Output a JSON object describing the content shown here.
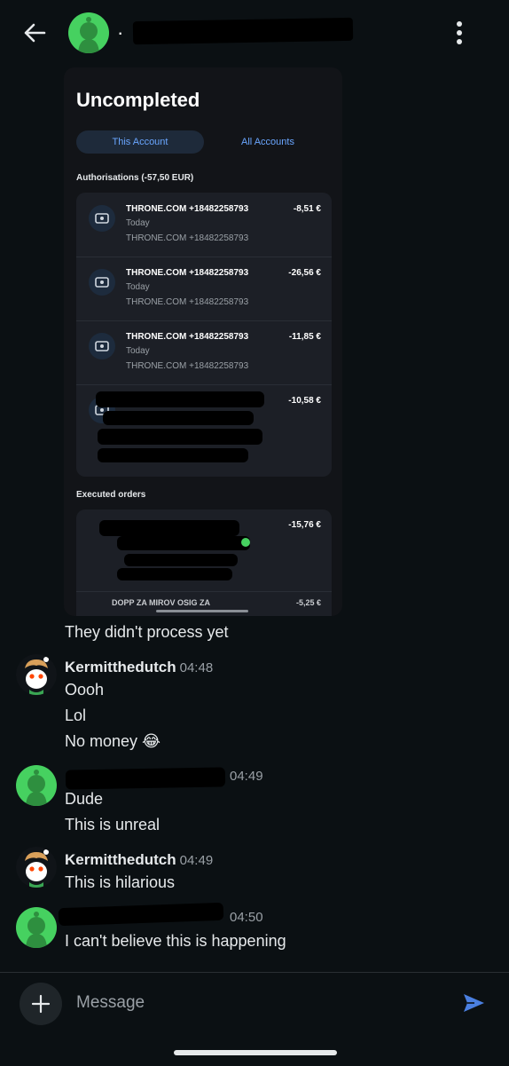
{
  "header": {
    "contact_name": "·",
    "back_icon": "arrow-left-icon",
    "menu_icon": "more-vertical-icon"
  },
  "shared_screenshot": {
    "title": "Uncompleted",
    "tabs": [
      "This Account",
      "All Accounts"
    ],
    "active_tab": "This Account",
    "authorisations_heading": "Authorisations (-57,50 EUR)",
    "transactions": [
      {
        "name": "THRONE.COM +18482258793",
        "amount": "-8,51 €",
        "day": "Today",
        "sub": "THRONE.COM +18482258793"
      },
      {
        "name": "THRONE.COM +18482258793",
        "amount": "-26,56 €",
        "day": "Today",
        "sub": "THRONE.COM +18482258793"
      },
      {
        "name": "THRONE.COM +18482258793",
        "amount": "-11,85 €",
        "day": "Today",
        "sub": "THRONE.COM +18482258793"
      },
      {
        "name": "",
        "amount": "-10,58 €",
        "day": "",
        "sub": ""
      }
    ],
    "executed_heading": "Executed orders",
    "executed": [
      {
        "amount": "-15,76 €"
      },
      {
        "name_cut": "DOPP ZA MIROV OSIG ZA",
        "amount_cut": "-5,25 €"
      }
    ]
  },
  "messages": [
    {
      "type": "text",
      "text": "They didn't process yet"
    },
    {
      "type": "author",
      "name": "Kermitthedutch",
      "time": "04:48"
    },
    {
      "type": "text",
      "text": "Oooh"
    },
    {
      "type": "text",
      "text": "Lol"
    },
    {
      "type": "text",
      "text": "No money 😂"
    },
    {
      "type": "author",
      "name": "",
      "time": "04:49"
    },
    {
      "type": "text",
      "text": "Dude"
    },
    {
      "type": "text",
      "text": "This is unreal"
    },
    {
      "type": "author",
      "name": "Kermitthedutch",
      "time": "04:49"
    },
    {
      "type": "text",
      "text": "This is hilarious"
    },
    {
      "type": "author",
      "name": "",
      "time": "04:50"
    },
    {
      "type": "text",
      "text": "I can't believe this is happening"
    }
  ],
  "composer": {
    "placeholder": "Message",
    "plus_icon": "plus-icon",
    "send_icon": "send-icon"
  },
  "colors": {
    "background": "#0b1013",
    "avatar_green": "#46d160",
    "accent_blue": "#4a7fe0",
    "link_blue": "#6aa6ff"
  }
}
